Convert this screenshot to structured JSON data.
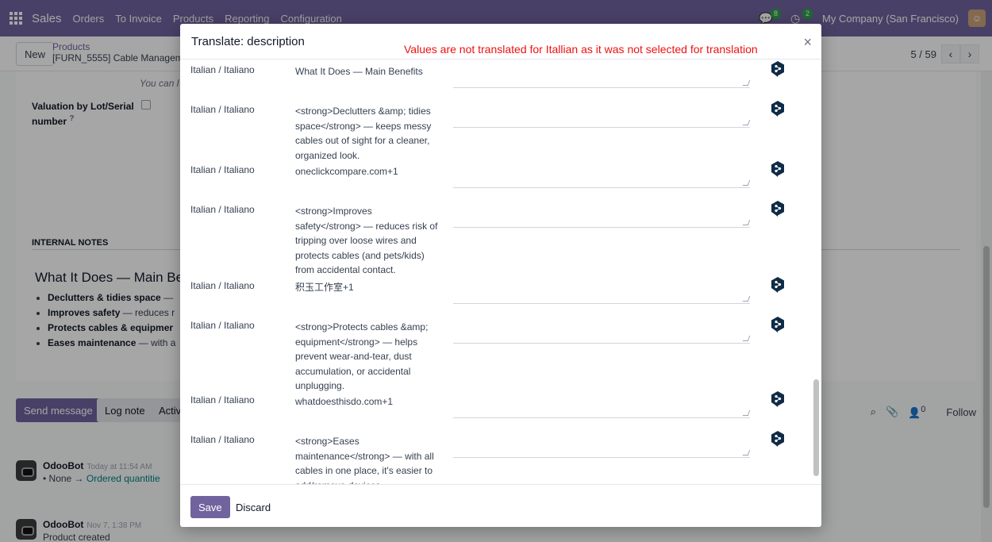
{
  "navbar": {
    "app_name": "Sales",
    "menu": [
      "Orders",
      "To Invoice",
      "Products",
      "Reporting",
      "Configuration"
    ],
    "messages_count": "8",
    "activities_count": "2",
    "company": "My Company (San Francisco)"
  },
  "control": {
    "new_label": "New",
    "breadcrumb_parent": "Products",
    "record_name": "[FURN_5555] Cable Managem",
    "pager": "5 / 59"
  },
  "sheet": {
    "italic_hint": "You can l",
    "valuation_label": "Valuation by Lot/Serial",
    "valuation_label2": "number",
    "valuation_help": "?",
    "internal_notes": "INTERNAL NOTES",
    "notes_title": "What It Does — Main Be",
    "bullets": [
      {
        "bold": "Declutters & tidies space",
        "rest": " —"
      },
      {
        "bold": "Improves safety",
        "rest": " — reduces r"
      },
      {
        "bold": "Protects cables & equipmer",
        "rest": ""
      },
      {
        "bold": "Eases maintenance",
        "rest": " — with a"
      }
    ]
  },
  "chatter": {
    "send_message": "Send message",
    "log_note": "Log note",
    "activities": "Activ",
    "follower_count": "0",
    "follow": "Follow",
    "messages": [
      {
        "author": "OdooBot",
        "time": "Today at 11:54 AM",
        "body_prefix": "• None  → ",
        "body_link": "Ordered quantitie"
      },
      {
        "author": "OdooBot",
        "time": "Nov 7, 1:38 PM",
        "body_prefix": "Product created",
        "body_link": ""
      }
    ]
  },
  "modal": {
    "title": "Translate: description",
    "note": "Values are not translated for Itallian as it was not selected for translation",
    "close": "×",
    "rows": [
      {
        "lang": "Italian / Italiano",
        "source": "What It Does — Main Benefits",
        "value": ""
      },
      {
        "lang": "Italian / Italiano",
        "source": "<strong>Declutters &amp; tidies space</strong> — keeps messy cables out of sight for a cleaner, organized look.",
        "value": ""
      },
      {
        "lang": "Italian / Italiano",
        "source": "oneclickcompare.com+1",
        "value": ""
      },
      {
        "lang": "Italian / Italiano",
        "source": "<strong>Improves safety</strong> — reduces risk of tripping over loose wires and protects cables (and pets/kids) from accidental contact.",
        "value": ""
      },
      {
        "lang": "Italian / Italiano",
        "source": "积玉工作室+1",
        "value": ""
      },
      {
        "lang": "Italian / Italiano",
        "source": "<strong>Protects cables &amp; equipment</strong> — helps prevent wear-and-tear, dust accumulation, or accidental unplugging.",
        "value": ""
      },
      {
        "lang": "Italian / Italiano",
        "source": "whatdoesthisdo.com+1",
        "value": ""
      },
      {
        "lang": "Italian / Italiano",
        "source": "<strong>Eases maintenance</strong> — with all cables in one place, it's easier to add/remove devices.",
        "value": ""
      }
    ],
    "save": "Save",
    "discard": "Discard"
  },
  "colors": {
    "brand": "#71639e",
    "note_red": "#ee1111",
    "deepl": "#0f2b46"
  }
}
